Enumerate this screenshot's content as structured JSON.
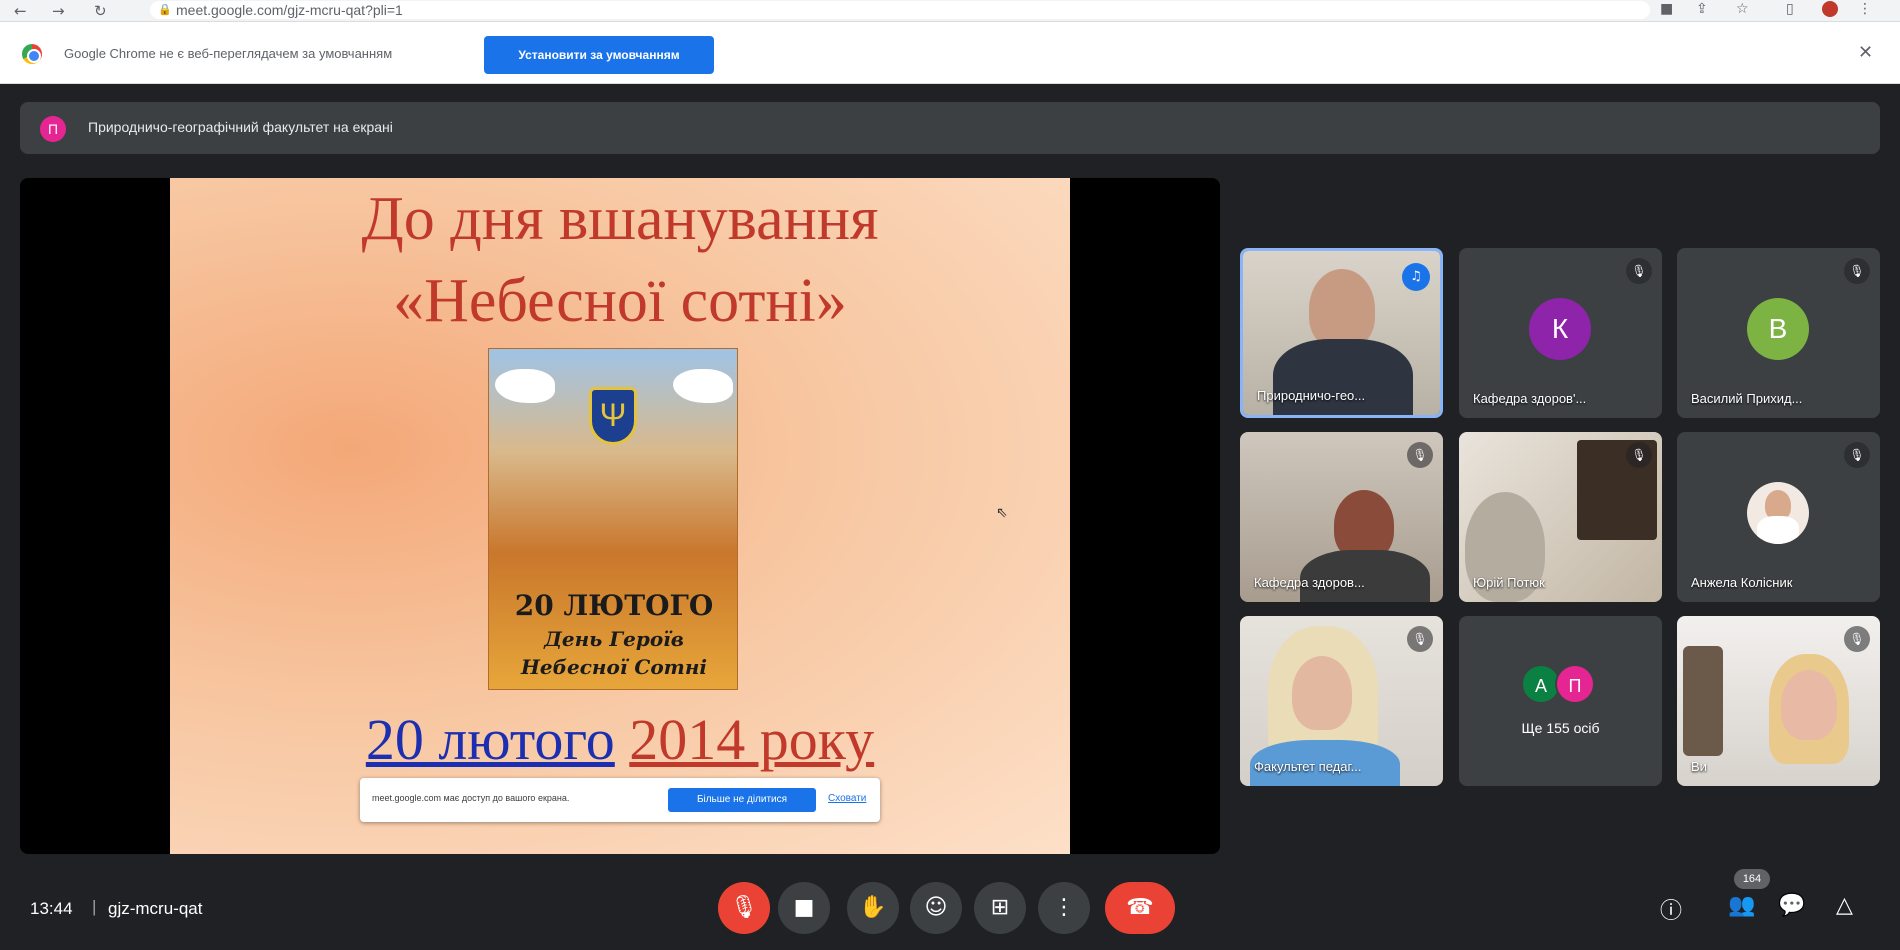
{
  "browser": {
    "url": "meet.google.com/gjz-mcru-qat?pli=1",
    "back": "←",
    "forward": "→",
    "reload": "↻"
  },
  "infobar": {
    "text": "Google Chrome не є веб-переглядачем за умовчанням",
    "button": "Установити за умовчанням",
    "close": "✕"
  },
  "presenting": {
    "avatar": "П",
    "text": "Природничо-географічний факультет на екрані"
  },
  "slide": {
    "title_line1": "До дня вшанування",
    "title_line2": "«Небесної сотні»",
    "poster_line1": "20 ЛЮТОГО",
    "poster_line2": "День Героїв",
    "poster_line3": "Небесної Сотні",
    "date_blue": "20 лютого",
    "date_red": "2014 року"
  },
  "share_notice": {
    "text": "meet.google.com має доступ до вашого екрана.",
    "stop_button": "Більше не ділитися",
    "hide_link": "Сховати"
  },
  "participants": [
    {
      "name": "Природничо-гео...",
      "type": "video",
      "speaking": true
    },
    {
      "name": "Кафедра здоров'...",
      "type": "avatar",
      "initial": "К",
      "color": "#8e24aa"
    },
    {
      "name": "Василий Прихид...",
      "type": "avatar",
      "initial": "В",
      "color": "#7cb342"
    },
    {
      "name": "Кафедра здоров...",
      "type": "video"
    },
    {
      "name": "Юрій Потюк",
      "type": "video"
    },
    {
      "name": "Анжела Колісник",
      "type": "avatar-photo"
    },
    {
      "name": "Факультет педаг...",
      "type": "video"
    },
    {
      "name": "Ще 155 осіб",
      "type": "more",
      "initials": [
        "А",
        "П"
      ],
      "colors": [
        "#0b8043",
        "#e52592"
      ]
    },
    {
      "name": "Ви",
      "type": "video"
    }
  ],
  "bottom": {
    "time": "13:44",
    "separator": "|",
    "meeting_code": "gjz-mcru-qat",
    "participant_count": "164"
  },
  "icons": {
    "mic_off": "🎙",
    "camera": "■",
    "hand": "✋",
    "emoji": "☺",
    "present": "⊞",
    "more": "⋮",
    "end_call": "☎",
    "info": "ⓘ",
    "people": "👥",
    "chat": "💬",
    "activities": "△"
  }
}
